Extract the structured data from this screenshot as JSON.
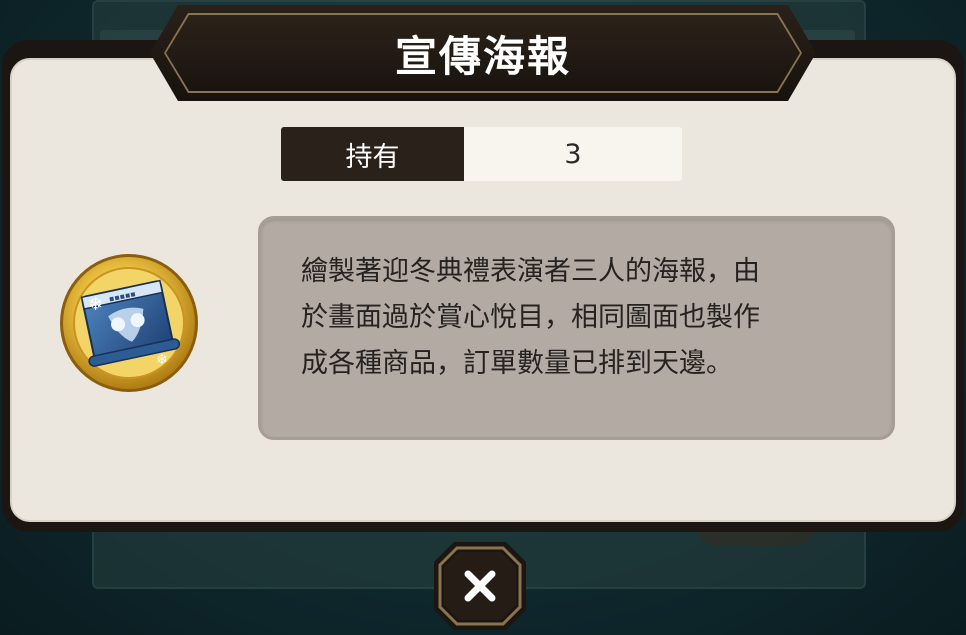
{
  "dialog": {
    "title": "宣傳海報",
    "owned_label": "持有",
    "owned_count": "3",
    "description": "繪製著迎冬典禮表演者三人的海報，由\n於畫面過於賞心悅目，相同圖面也製作\n成各種商品，訂單數量已排到天邊。",
    "item_icon": "poster-scroll-icon",
    "close_icon": "close-icon"
  },
  "colors": {
    "banner": "#1b1611",
    "panel": "#ebe7df",
    "desc_box": "#b3aaa4",
    "coin_gold": "#e2b53a",
    "poster_blue": "#2f5f96"
  }
}
